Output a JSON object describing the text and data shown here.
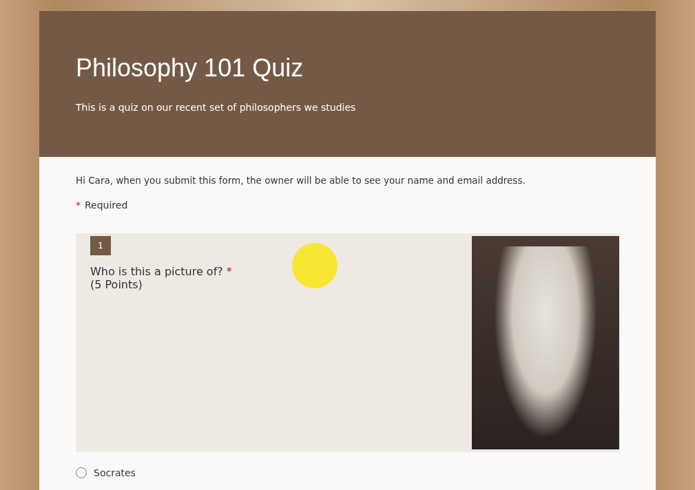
{
  "form": {
    "title": "Philosophy 101 Quiz",
    "description": "This is a quiz on our recent set of philosophers we studies",
    "notice": "Hi Cara, when you submit this form, the owner will be able to see your name and email address.",
    "required_legend": {
      "mark": "*",
      "label": "Required"
    },
    "questions": [
      {
        "number": "1",
        "title": "Who is this a picture of?",
        "required_mark": "*",
        "points": "(5 Points)",
        "options": [
          {
            "label": "Socrates",
            "selected": false
          }
        ]
      }
    ]
  }
}
